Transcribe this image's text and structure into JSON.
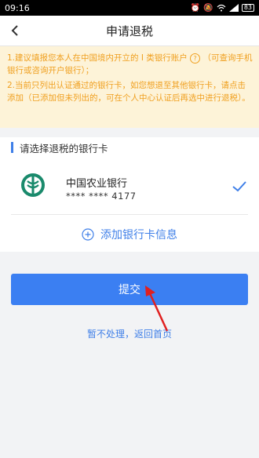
{
  "status_bar": {
    "time": "09:16",
    "battery": "83"
  },
  "header": {
    "title": "申请退税"
  },
  "notice": {
    "line1a": "1.建议填报您本人在中国境内开立的 I 类银行账户",
    "line1b": "（可查询手机银行或咨询开户银行）；",
    "line2": "2.当前只列出认证通过的银行卡，如您想退至其他银行卡，请点击添加（已添加但未列出的，可在个人中心认证后再选中进行退税）。",
    "help_symbol": "?"
  },
  "section": {
    "title": "请选择退税的银行卡"
  },
  "bank_card": {
    "name": "中国农业银行",
    "number": "**** **** 4177",
    "logo_color": "#1a8a6c"
  },
  "add_card": {
    "label": "添加银行卡信息"
  },
  "actions": {
    "submit_label": "提交",
    "later_label": "暂不处理，返回首页"
  },
  "colors": {
    "accent": "#3b7ff2",
    "notice_text": "#f0a020",
    "notice_bg": "#fdf3d8",
    "annotation_arrow": "#e02020"
  }
}
